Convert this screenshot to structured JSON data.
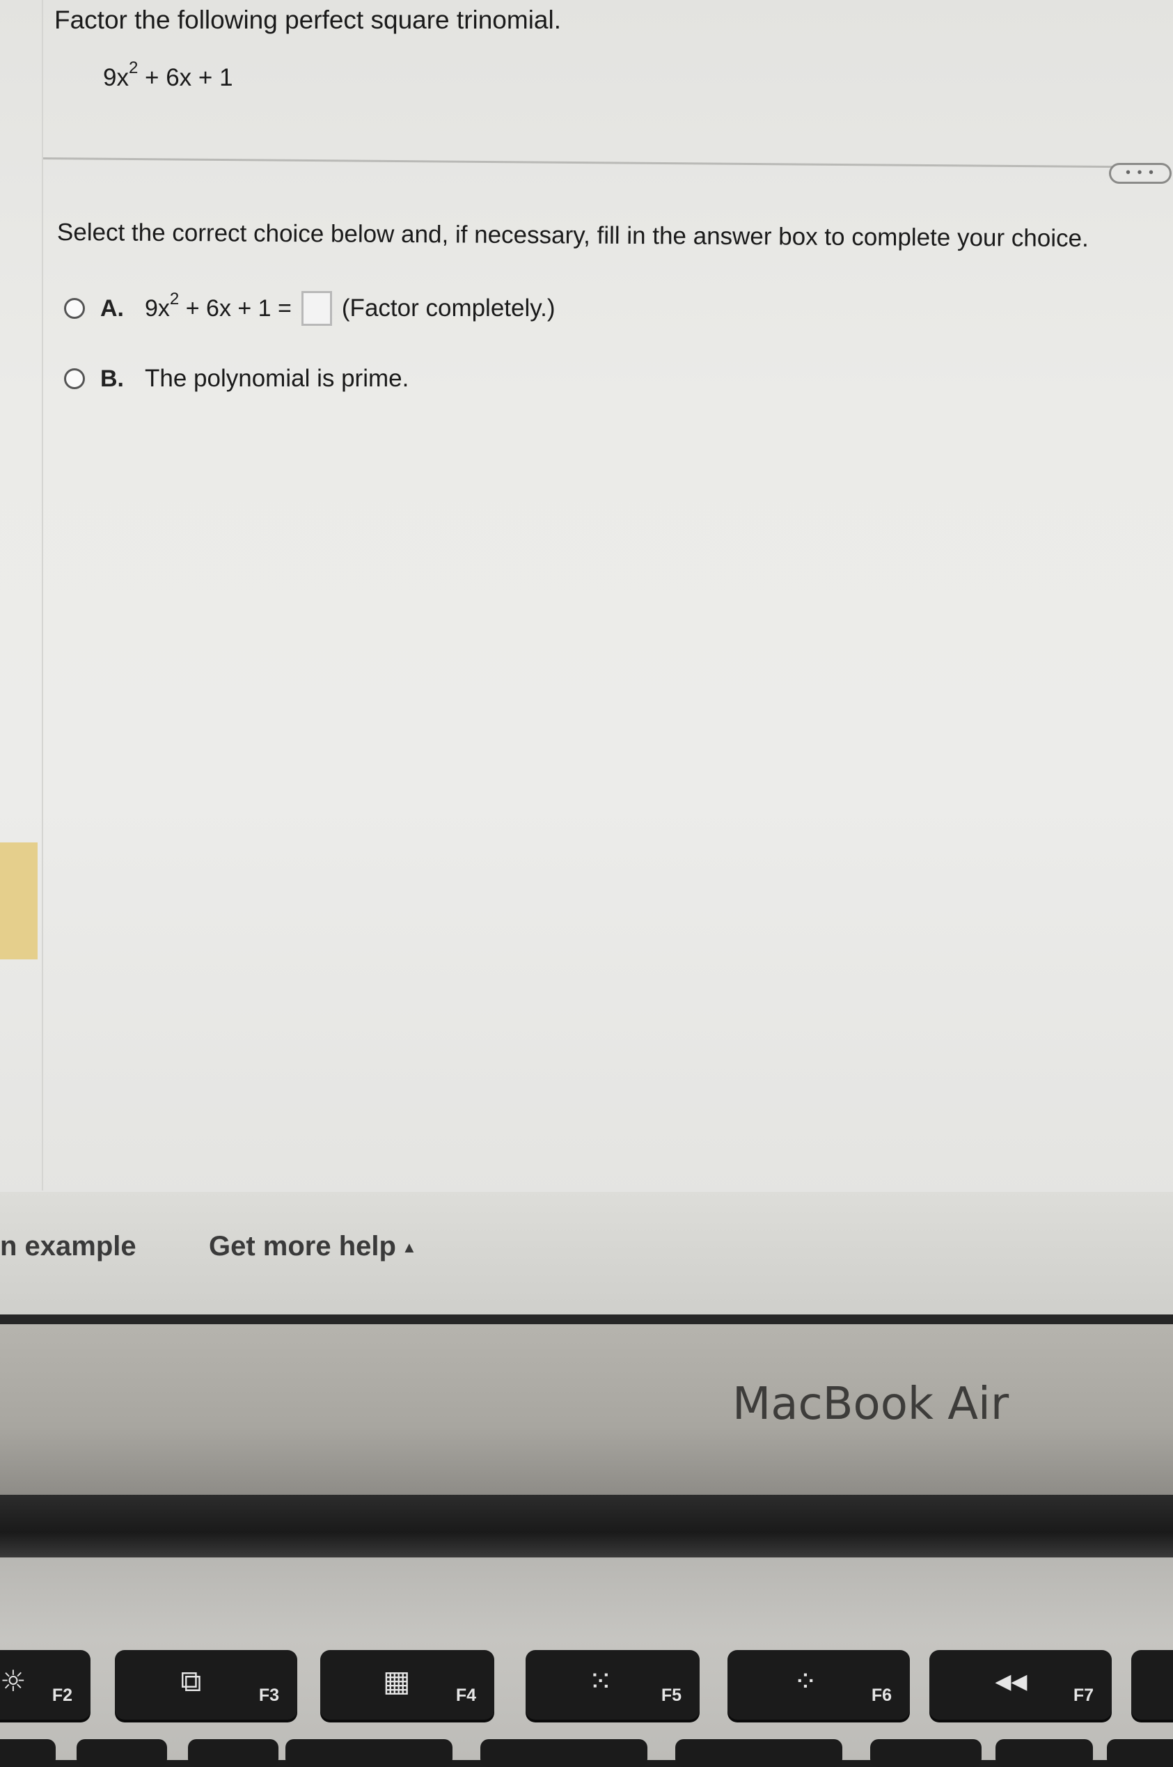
{
  "question": {
    "title": "Factor the following perfect square trinomial.",
    "expression": {
      "coef": "9x",
      "power": "2",
      "rest": " + 6x + 1"
    }
  },
  "more_button": {
    "label": "• • •"
  },
  "instruction": "Select the correct choice below and, if necessary, fill in the answer box to complete your choice.",
  "options": [
    {
      "letter": "A.",
      "expr_coef": "9x",
      "expr_power": "2",
      "expr_rest": " + 6x + 1 =",
      "suffix": "(Factor completely.)",
      "answer_value": ""
    },
    {
      "letter": "B.",
      "text": "The polynomial is prime."
    }
  ],
  "bottom_bar": {
    "example_link": "n example",
    "help_link": "Get more help",
    "help_caret": "▲"
  },
  "laptop": {
    "brand": "MacBook Air",
    "keys": [
      {
        "fn": "F2",
        "glyph": "☼"
      },
      {
        "fn": "F3",
        "glyph": "⧉"
      },
      {
        "fn": "F4",
        "glyph": "▦"
      },
      {
        "fn": "F5",
        "glyph": "⁙"
      },
      {
        "fn": "F6",
        "glyph": "⁘"
      },
      {
        "fn": "F7",
        "glyph": "◀◀"
      }
    ]
  },
  "colors": {
    "screen_bg": "#ebebe8",
    "yellow_tab": "#e5cf8c",
    "key": "#1b1b1b",
    "bezel": "#a8a6a0"
  }
}
